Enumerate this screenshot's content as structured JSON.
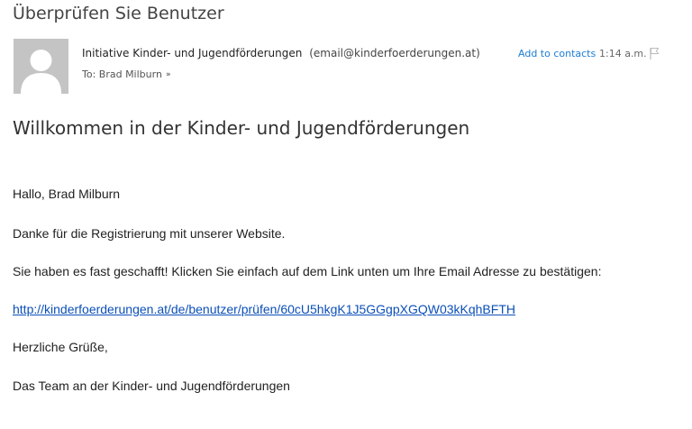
{
  "email": {
    "subject": "Überprüfen Sie Benutzer",
    "sender": {
      "name": "Initiative Kinder- und Jugendförderungen",
      "email": "(email@kinderfoerderungen.at)"
    },
    "add_contacts_label": "Add to contacts",
    "time": "1:14 a.m.",
    "to_line": "To: Brad Milburn",
    "icons": {
      "avatar": "user-silhouette-icon",
      "flag": "flag-icon",
      "expand": "chevron-double-down-icon"
    }
  },
  "message": {
    "headline": "Willkommen in der Kinder- und Jugendförderungen",
    "greeting": "Hallo, Brad Milburn",
    "thanks": "Danke für die Registrierung mit unserer Website.",
    "instruction": "Sie haben es fast geschafft! Klicken Sie einfach auf dem Link unten um Ihre Email Adresse zu bestätigen:",
    "link": "http://kinderfoerderungen.at/de/benutzer/prüfen/60cU5hkgK1J5GGgpXGQW03kKqhBFTH",
    "closing": "Herzliche Grüße,",
    "signature": "Das Team an der Kinder- und Jugendförderungen"
  },
  "colors": {
    "link": "#0b4fb8",
    "accent": "#1c7cd5",
    "avatar_bg": "#c4c4c4"
  }
}
